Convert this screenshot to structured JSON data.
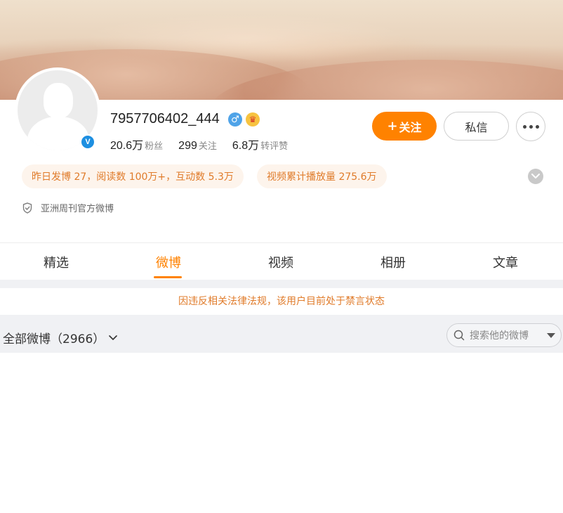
{
  "profile": {
    "name": "7957706402_444",
    "verified_badge": "V",
    "gender_icon": "♂",
    "crown_icon": "♛",
    "stats": [
      {
        "value": "20.6万",
        "label": "粉丝"
      },
      {
        "value": "299",
        "label": "关注"
      },
      {
        "value": "6.8万",
        "label": "转评赞"
      }
    ]
  },
  "actions": {
    "follow_plus": "+",
    "follow_label": "关注",
    "message_label": "私信"
  },
  "highlights": {
    "pill1": "昨日发博 27，阅读数 100万+，互动数 5.3万",
    "pill2": "视频累计播放量 275.6万"
  },
  "description": "亚洲周刊官方微博",
  "tabs": [
    "精选",
    "微博",
    "视频",
    "相册",
    "文章"
  ],
  "active_tab": "微博",
  "notice": "因违反相关法律法规，该用户目前处于禁言状态",
  "feed": {
    "filter_label": "全部微博（2966）",
    "search_placeholder": "搜索他的微博"
  },
  "colors": {
    "accent": "#ff8200",
    "notice": "#e07b2a",
    "verified": "#1d8fe1"
  }
}
